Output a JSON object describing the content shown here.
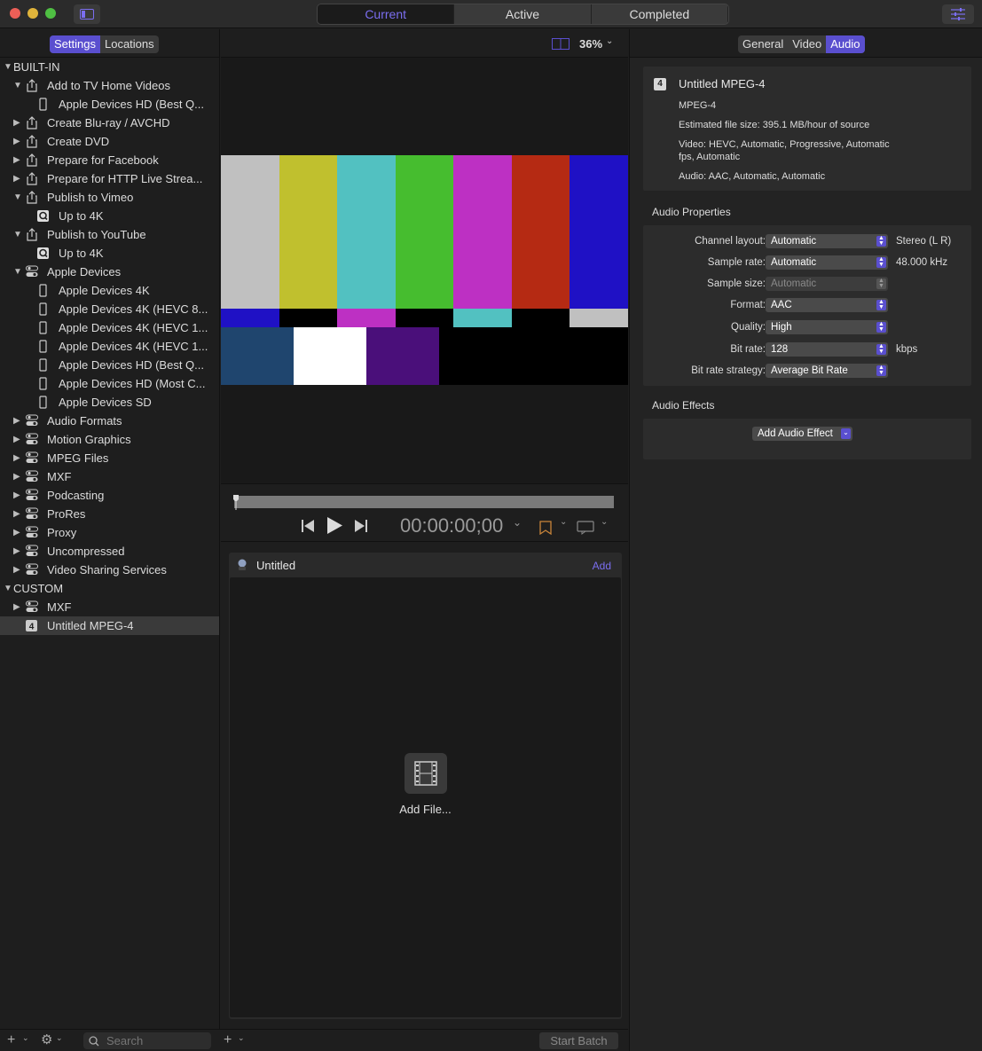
{
  "window": {
    "tabs": [
      {
        "label": "Current",
        "selected": true
      },
      {
        "label": "Active",
        "selected": false
      },
      {
        "label": "Completed",
        "selected": false
      }
    ]
  },
  "sidebar": {
    "segments": [
      "Settings",
      "Locations"
    ],
    "search_placeholder": "Search",
    "tree": [
      {
        "label": "BUILT-IN",
        "type": "section",
        "expanded": true
      },
      {
        "label": "Add to TV Home Videos",
        "type": "share",
        "expanded": true
      },
      {
        "label": "Apple Devices HD (Best Q...",
        "type": "device"
      },
      {
        "label": "Create Blu-ray / AVCHD",
        "type": "share",
        "expanded": false
      },
      {
        "label": "Create DVD",
        "type": "share",
        "expanded": false
      },
      {
        "label": "Prepare for Facebook",
        "type": "share",
        "expanded": false
      },
      {
        "label": "Prepare for HTTP Live Strea...",
        "type": "share",
        "expanded": false
      },
      {
        "label": "Publish to Vimeo",
        "type": "share",
        "expanded": true
      },
      {
        "label": "Up to 4K",
        "type": "quicktime"
      },
      {
        "label": "Publish to YouTube",
        "type": "share",
        "expanded": true
      },
      {
        "label": "Up to 4K",
        "type": "quicktime"
      },
      {
        "label": "Apple Devices",
        "type": "group",
        "expanded": true
      },
      {
        "label": "Apple Devices 4K",
        "type": "device"
      },
      {
        "label": "Apple Devices 4K (HEVC 8...",
        "type": "device"
      },
      {
        "label": "Apple Devices 4K (HEVC 1...",
        "type": "device"
      },
      {
        "label": "Apple Devices 4K (HEVC 1...",
        "type": "device"
      },
      {
        "label": "Apple Devices HD (Best Q...",
        "type": "device"
      },
      {
        "label": "Apple Devices HD (Most C...",
        "type": "device"
      },
      {
        "label": "Apple Devices SD",
        "type": "device"
      },
      {
        "label": "Audio Formats",
        "type": "group",
        "expanded": false
      },
      {
        "label": "Motion Graphics",
        "type": "group",
        "expanded": false
      },
      {
        "label": "MPEG Files",
        "type": "group",
        "expanded": false
      },
      {
        "label": "MXF",
        "type": "group",
        "expanded": false
      },
      {
        "label": "Podcasting",
        "type": "group",
        "expanded": false
      },
      {
        "label": "ProRes",
        "type": "group",
        "expanded": false
      },
      {
        "label": "Proxy",
        "type": "group",
        "expanded": false
      },
      {
        "label": "Uncompressed",
        "type": "group",
        "expanded": false
      },
      {
        "label": "Video Sharing Services",
        "type": "group",
        "expanded": false
      },
      {
        "label": "CUSTOM",
        "type": "section",
        "expanded": true
      },
      {
        "label": "MXF",
        "type": "group",
        "expanded": false
      },
      {
        "label": "Untitled MPEG-4",
        "type": "custom",
        "selected": true,
        "badge": "4"
      }
    ]
  },
  "viewer": {
    "zoom": "36%",
    "timecode": "00:00:00;00",
    "colorbars": {
      "top": [
        "#c0c0c0",
        "#c0c02e",
        "#52c1c1",
        "#46bd2f",
        "#bd30c3",
        "#b52a13",
        "#1f11c5"
      ],
      "middle": [
        "#1f11c5",
        "#000000",
        "#bd30c3",
        "#000000",
        "#52c1c1",
        "#000000",
        "#c0c0c0"
      ],
      "bottom": [
        "#1f456e",
        "#ffffff",
        "#4a0f7a",
        "#000000",
        "#000000",
        "#000000",
        "#000000"
      ]
    }
  },
  "batch": {
    "title": "Untitled",
    "add_label": "Add",
    "add_file_label": "Add File...",
    "start_batch_label": "Start Batch"
  },
  "inspector": {
    "tabs": [
      {
        "label": "General",
        "selected": false
      },
      {
        "label": "Video",
        "selected": false
      },
      {
        "label": "Audio",
        "selected": true
      }
    ],
    "summary": {
      "badge": "4",
      "title": "Untitled MPEG-4",
      "format": "MPEG-4",
      "file_size": "Estimated file size: 395.1 MB/hour of source",
      "video_line1": "Video: HEVC, Automatic, Progressive, Automatic",
      "video_line2": "fps, Automatic",
      "audio": "Audio: AAC, Automatic, Automatic"
    },
    "audio_properties_title": "Audio Properties",
    "properties": [
      {
        "label": "Channel layout:",
        "value": "Automatic",
        "unit": "Stereo (L R)",
        "disabled": false
      },
      {
        "label": "Sample rate:",
        "value": "Automatic",
        "unit": "48.000 kHz",
        "disabled": false
      },
      {
        "label": "Sample size:",
        "value": "Automatic",
        "unit": "",
        "disabled": true
      },
      {
        "label": "Format:",
        "value": "AAC",
        "unit": "",
        "disabled": false
      },
      {
        "label": "Quality:",
        "value": "High",
        "unit": "",
        "disabled": false
      },
      {
        "label": "Bit rate:",
        "value": "128",
        "unit": "kbps",
        "disabled": false
      },
      {
        "label": "Bit rate strategy:",
        "value": "Average Bit Rate",
        "unit": "",
        "disabled": false
      }
    ],
    "audio_effects_title": "Audio Effects",
    "add_audio_effect_label": "Add Audio Effect"
  },
  "colors": {
    "accent": "#5a4fcf",
    "accent_text": "#7b6ef0"
  }
}
